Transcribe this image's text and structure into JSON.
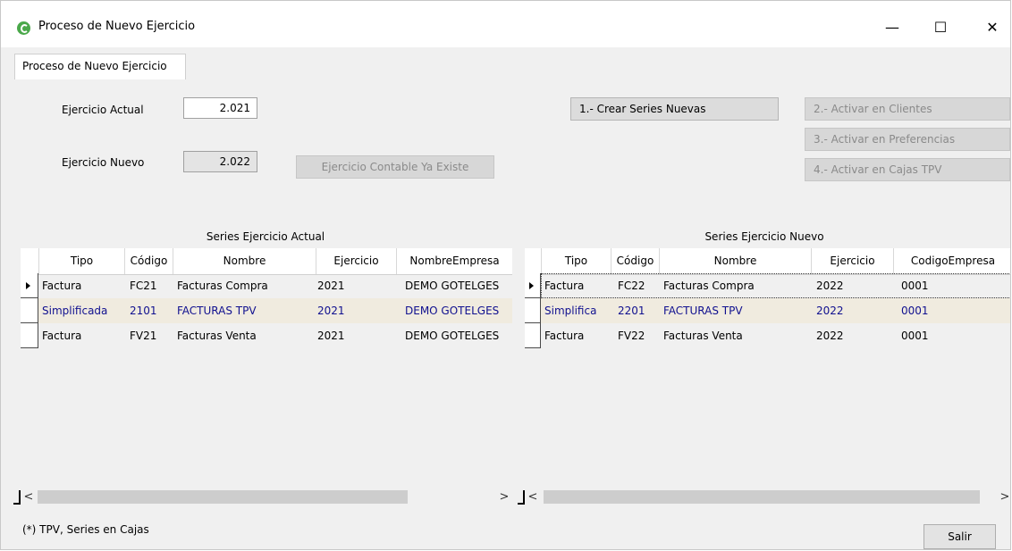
{
  "window": {
    "title": "Proceso de Nuevo Ejercicio",
    "minimize": "—",
    "maximize": "☐",
    "close": "✕"
  },
  "tabs": [
    {
      "label": "Proceso de Nuevo Ejercicio"
    }
  ],
  "form": {
    "ejercicio_actual_label": "Ejercicio Actual",
    "ejercicio_actual_value": "2.021",
    "ejercicio_nuevo_label": "Ejercicio Nuevo",
    "ejercicio_nuevo_value": "2.022",
    "contable_existe_button": "Ejercicio Contable Ya Existe"
  },
  "actions": {
    "crear_series": "1.- Crear Series Nuevas",
    "activar_clientes": "2.- Activar en Clientes",
    "activar_preferencias": "3.- Activar en Preferencias",
    "activar_cajas": "4.- Activar en Cajas TPV"
  },
  "grid_actual": {
    "caption": "Series Ejercicio Actual",
    "columns": [
      "Tipo",
      "Código",
      "Nombre",
      "Ejercicio",
      "NombreEmpresa"
    ],
    "rows": [
      [
        "Factura",
        "FC21",
        "Facturas Compra",
        "2021",
        "DEMO GOTELGES"
      ],
      [
        "Simplificada",
        "2101",
        "FACTURAS TPV",
        "2021",
        "DEMO GOTELGES"
      ],
      [
        "Factura",
        "FV21",
        "Facturas Venta",
        "2021",
        "DEMO GOTELGES"
      ]
    ],
    "selected_row": 1
  },
  "grid_nuevo": {
    "caption": "Series Ejercicio Nuevo",
    "columns": [
      "Tipo",
      "Código",
      "Nombre",
      "Ejercicio",
      "CodigoEmpresa"
    ],
    "rows": [
      [
        "Factura",
        "FC22",
        "Facturas Compra",
        "2022",
        "0001"
      ],
      [
        "Simplifica",
        "2201",
        "FACTURAS TPV",
        "2022",
        "0001"
      ],
      [
        "Factura",
        "FV22",
        "Facturas Venta",
        "2022",
        "0001"
      ]
    ],
    "selected_row": 1
  },
  "footer": {
    "note": "(*) TPV, Series en Cajas",
    "salir": "Salir"
  },
  "scroll": {
    "left": "<",
    "right": ">"
  }
}
